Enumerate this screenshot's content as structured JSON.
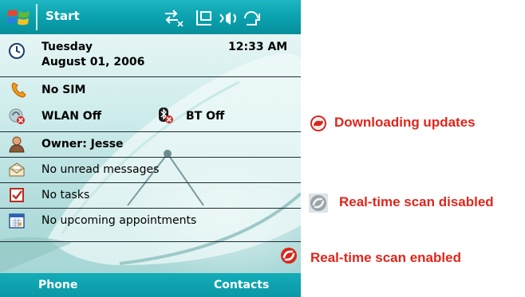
{
  "title_bar": {
    "title": "Start",
    "status_icons": [
      "connectivity-icon",
      "sync-icon",
      "volume-icon",
      "battery-icon"
    ]
  },
  "today": {
    "date_line1": "Tuesday",
    "date_line2": "August 01, 2006",
    "time": "12:33 AM",
    "phone_status": "No SIM",
    "wlan": "WLAN Off",
    "bluetooth": "BT Off",
    "owner": "Owner: Jesse",
    "messages": "No unread messages",
    "tasks": "No tasks",
    "appointments": "No upcoming appointments"
  },
  "softkeys": {
    "left": "Phone",
    "right": "Contacts"
  },
  "legend": {
    "downloading": "Downloading updates",
    "scan_disabled": "Real-time scan disabled",
    "scan_enabled": "Real-time scan enabled"
  },
  "colors": {
    "accent": "#0aa0ad",
    "legend_text": "#e0261c"
  }
}
